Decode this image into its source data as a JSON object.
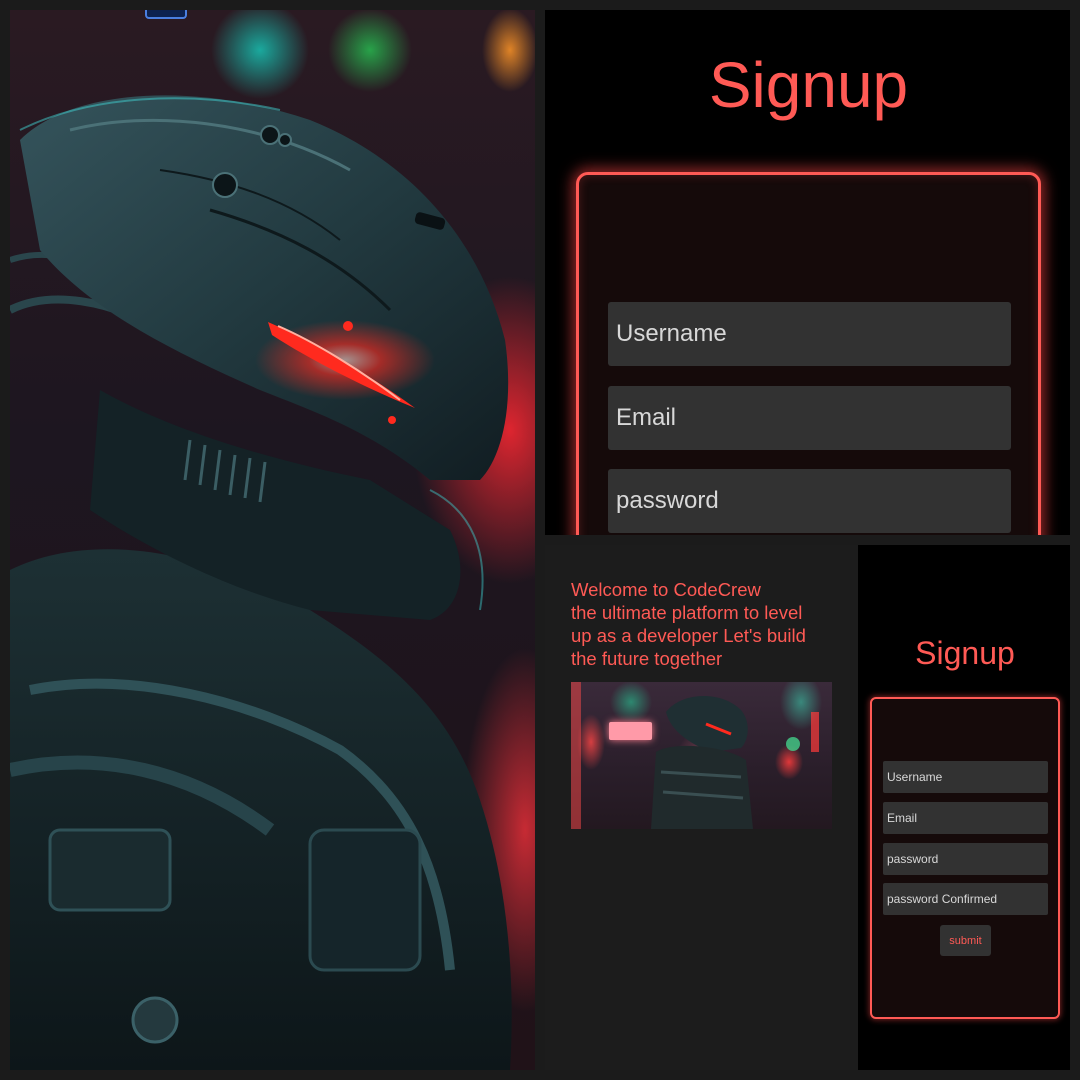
{
  "large_signup": {
    "title": "Signup",
    "fields": [
      {
        "placeholder": "Username"
      },
      {
        "placeholder": "Email"
      },
      {
        "placeholder": "password"
      }
    ]
  },
  "welcome": {
    "lines": [
      "Welcome to CodeCrew",
      "the ultimate platform to level",
      "up as a developer Let's build",
      "the future together"
    ]
  },
  "small_signup": {
    "title": "Signup",
    "fields": [
      {
        "placeholder": "Username"
      },
      {
        "placeholder": "Email"
      },
      {
        "placeholder": "password"
      },
      {
        "placeholder": "password Confirmed"
      }
    ],
    "submit_label": "submit"
  },
  "colors": {
    "accent": "#ff5a55",
    "panel_black": "#000000",
    "input_bg": "#323232",
    "canvas": "#1b1b1b"
  }
}
